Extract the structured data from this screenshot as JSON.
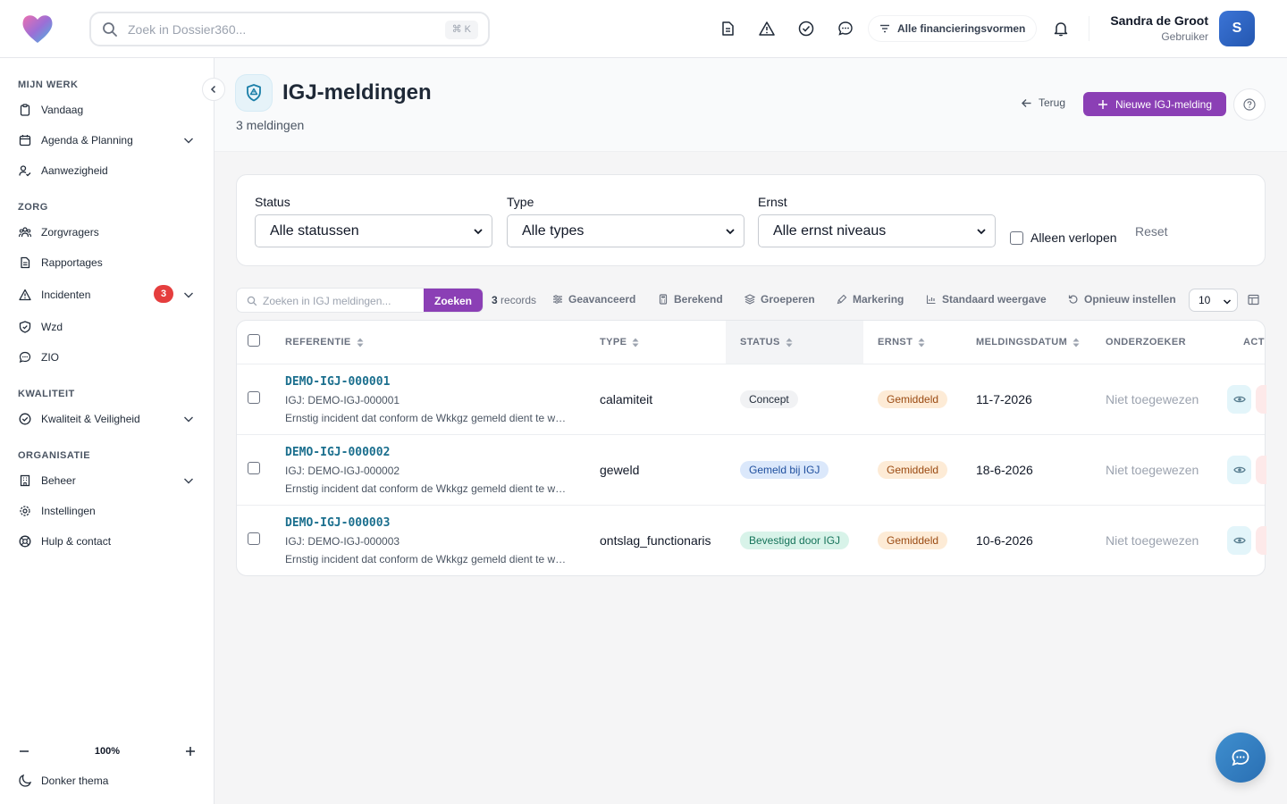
{
  "topbar": {
    "search_placeholder": "Zoek in Dossier360...",
    "search_shortcut": "⌘ K",
    "financing_filter": "Alle financieringsvormen",
    "user": {
      "name": "Sandra de Groot",
      "role": "Gebruiker",
      "initial": "S"
    }
  },
  "sidebar": {
    "sections": [
      {
        "label": "MIJN WERK"
      },
      {
        "label": "ZORG"
      },
      {
        "label": "KWALITEIT"
      },
      {
        "label": "ORGANISATIE"
      }
    ],
    "items": {
      "vandaag": "Vandaag",
      "agenda": "Agenda & Planning",
      "aanwezigheid": "Aanwezigheid",
      "zorgvragers": "Zorgvragers",
      "rapportages": "Rapportages",
      "incidenten": "Incidenten",
      "incidenten_badge": "3",
      "wzd": "Wzd",
      "zio": "ZIO",
      "kwaliteit": "Kwaliteit & Veiligheid",
      "beheer": "Beheer",
      "instellingen": "Instellingen",
      "hulp": "Hulp & contact"
    },
    "zoom": "100%",
    "theme_toggle": "Donker thema"
  },
  "page": {
    "title": "IGJ-meldingen",
    "subtitle": "3 meldingen",
    "back_label": "Terug",
    "new_label": "Nieuwe IGJ-melding"
  },
  "filters": {
    "status_label": "Status",
    "status_value": "Alle statussen",
    "type_label": "Type",
    "type_value": "Alle types",
    "ernst_label": "Ernst",
    "ernst_value": "Alle ernst niveaus",
    "only_expired": "Alleen verlopen",
    "reset": "Reset"
  },
  "toolbar": {
    "search_placeholder": "Zoeken in IGJ meldingen...",
    "search_button": "Zoeken",
    "record_count": "3",
    "record_label": "records",
    "advanced": "Geavanceerd",
    "calculated": "Berekend",
    "group": "Groeperen",
    "marking": "Markering",
    "default_view": "Standaard weergave",
    "reset_view": "Opnieuw instellen",
    "page_size": "10"
  },
  "table": {
    "headers": {
      "referentie": "REFERENTIE",
      "type": "TYPE",
      "status": "STATUS",
      "ernst": "ERNST",
      "datum": "MELDINGSDATUM",
      "onderzoeker": "ONDERZOEKER",
      "acties": "ACTI"
    },
    "rows": [
      {
        "ref": "DEMO-IGJ-000001",
        "sub": "IGJ: DEMO-IGJ-000001",
        "desc": "Ernstig incident dat conform de Wkkgz gemeld dient te worden bij de IGJ",
        "type": "calamiteit",
        "status": "Concept",
        "ernst": "Gemiddeld",
        "datum": "11-7-2026",
        "onderzoeker": "Niet toegewezen"
      },
      {
        "ref": "DEMO-IGJ-000002",
        "sub": "IGJ: DEMO-IGJ-000002",
        "desc": "Ernstig incident dat conform de Wkkgz gemeld dient te worden bij de IGJ",
        "type": "geweld",
        "status": "Gemeld bij IGJ",
        "ernst": "Gemiddeld",
        "datum": "18-6-2026",
        "onderzoeker": "Niet toegewezen"
      },
      {
        "ref": "DEMO-IGJ-000003",
        "sub": "IGJ: DEMO-IGJ-000003",
        "desc": "Ernstig incident dat conform de Wkkgz gemeld dient te worden bij de IGJ",
        "type": "ontslag_functionaris",
        "status": "Bevestigd door IGJ",
        "ernst": "Gemiddeld",
        "datum": "10-6-2026",
        "onderzoeker": "Niet toegewezen"
      }
    ]
  },
  "colors": {
    "accent": "#8b3fb5",
    "link": "#1b6f8e",
    "danger_badge": "#e53e3e",
    "ernst_bg": "#fdebd6",
    "ernst_fg": "#9a4a12"
  }
}
